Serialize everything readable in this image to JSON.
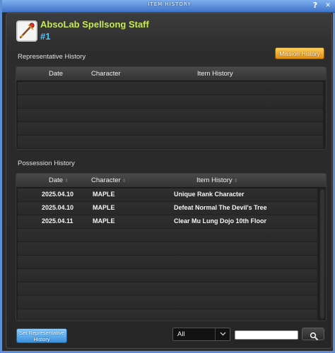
{
  "titlebar": {
    "title": "ITEM HISTORY",
    "help": "?",
    "close": "✕"
  },
  "item": {
    "name": "AbsoLab Spellsong Staff",
    "number": "#1",
    "icon": "staff-icon"
  },
  "representative": {
    "label": "Representative History",
    "mission_button": "Mission History",
    "columns": [
      "Date",
      "Character",
      "Item History"
    ],
    "rows": []
  },
  "possession": {
    "label": "Possession History",
    "columns": [
      "Date",
      "Character",
      "Item History"
    ],
    "rows": [
      {
        "date": "2025.04.10",
        "character": "MAPLE",
        "history": "Unique Rank Character"
      },
      {
        "date": "2025.04.10",
        "character": "MAPLE",
        "history": "Defeat Normal The Devil's Tree"
      },
      {
        "date": "2025.04.11",
        "character": "MAPLE",
        "history": "Clear Mu Lung Dojo 10th Floor"
      }
    ]
  },
  "footer": {
    "set_representative": "Set Representative History",
    "filter_value": "All",
    "search_value": "",
    "search_icon": "search-icon"
  },
  "colors": {
    "accent_name": "#c5e95a",
    "accent_number": "#4dc6ff",
    "mission_button": "#f0a020",
    "set_button": "#4aa3ea"
  }
}
